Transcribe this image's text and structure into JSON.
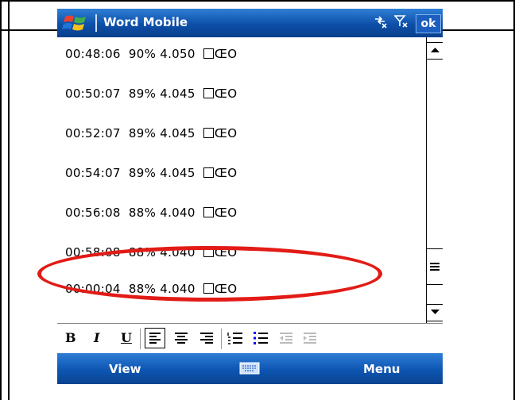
{
  "window": {
    "title": "Word Mobile",
    "ok_label": "ok",
    "status_icons": [
      "connectivity-icon",
      "signal-off-icon",
      "volume-icon"
    ]
  },
  "document": {
    "lines": [
      {
        "time": "00:48:06",
        "percent": "90%",
        "voltage": "4.050",
        "trail": "ŒO"
      },
      {
        "time": "00:50:07",
        "percent": "89%",
        "voltage": "4.045",
        "trail": "ŒO"
      },
      {
        "time": "00:52:07",
        "percent": "89%",
        "voltage": "4.045",
        "trail": "ŒO"
      },
      {
        "time": "00:54:07",
        "percent": "89%",
        "voltage": "4.045",
        "trail": "ŒO"
      },
      {
        "time": "00:56:08",
        "percent": "88%",
        "voltage": "4.040",
        "trail": "ŒO"
      },
      {
        "time": "00:58:08",
        "percent": "88%",
        "voltage": "4.040",
        "trail": "ŒO"
      },
      {
        "time": "00:00:04",
        "percent": "88%",
        "voltage": "4.040",
        "trail": "ŒO"
      }
    ],
    "highlighted_line_index": 6
  },
  "toolbar": {
    "bold_label": "B",
    "italic_label": "I",
    "underline_label": "U",
    "items": [
      "align-left-icon",
      "align-center-icon",
      "align-right-icon",
      "numbered-list-icon",
      "bullet-list-icon",
      "decrease-indent-icon",
      "increase-indent-icon"
    ]
  },
  "softkeys": {
    "left_label": "View",
    "right_label": "Menu",
    "center_icon": "keyboard-icon"
  },
  "colors": {
    "titlebar": "#0c4fa8",
    "annotation": "#e21b16"
  }
}
